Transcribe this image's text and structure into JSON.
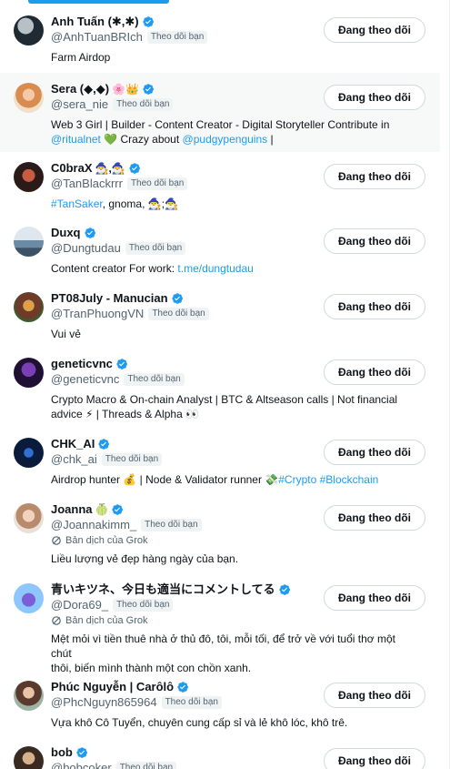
{
  "follow_label": "Đang theo dõi",
  "follows_you_label": "Theo dõi bạn",
  "grok_label": "Bản dịch của Grok",
  "colors": {
    "accent": "#1d9bf0",
    "verified": "#1d9bf0",
    "text": "#0f1419",
    "muted": "#536471",
    "border": "#cfd9de",
    "highlight_row": "#f7f9f9"
  },
  "users": [
    {
      "name": "Anh Tuấn (✱,✱)",
      "handle": "@AnhTuanBRIch",
      "bio": [
        "Farm Airdop"
      ]
    },
    {
      "name": "Sera (◆,◆)",
      "name_emoji": "🌸👑",
      "handle": "@sera_nie",
      "bio_prefix": "Web 3 Girl | Builder - Content Creator - Digital Storyteller Contribute in",
      "bio_link1": "@ritualnet",
      "bio_mid": "💚 Crazy about",
      "bio_link2": "@pudgypenguins",
      "bio_suffix": "|"
    },
    {
      "name": "C0braX",
      "name_emoji": "🧙‍♂️,🧙‍♂️",
      "handle": "@TanBlackrrr",
      "bio_link1": "#TanSaker",
      "bio_suffix": ", gnoma, 🧙‍♂️;🧙‍♂️"
    },
    {
      "name": "Duxq",
      "handle": "@Dungtudau",
      "bio_prefix": "Content creator For work:",
      "bio_link1": "t.me/dungtudau"
    },
    {
      "name": "PT08July - Manucian",
      "handle": "@TranPhuongVN",
      "bio": [
        "Vui vẻ"
      ]
    },
    {
      "name": "geneticvnc",
      "handle": "@geneticvnc",
      "bio": [
        "Crypto Macro & On-chain Analyst | BTC & Altseason calls | Not financial",
        "advice ⚡ | Threads & Alpha 👀"
      ]
    },
    {
      "name": "CHK_AI",
      "handle": "@chk_ai",
      "bio_prefix": "Airdrop hunter 💰 | Node & Validator runner 💸",
      "bio_link1": "#Crypto",
      "bio_link2": "#Blockchain"
    },
    {
      "name": "Joanna",
      "name_emoji": "🍈",
      "handle": "@Joannakimm_",
      "grok": true,
      "bio": [
        "Liều lượng vẻ đẹp hàng ngày của bạn."
      ]
    },
    {
      "name": "青いキツネ、今日も適当にコメントしてる",
      "handle": "@Dora69_",
      "grok": true,
      "bio": [
        "Mệt mỏi vì tiền thuê nhà ở thủ đô, tôi, mỗi tối, để trở về với tuổi thơ một chút",
        "thôi, biến mình thành một con chồn xanh."
      ]
    },
    {
      "name": "Phúc Nguyễn | Carôlô",
      "handle": "@PhcNguyn865964",
      "bio": [
        "Vựa khô Cô Tuyển, chuyên cung cấp sỉ và lẻ khô lóc, khô trê."
      ]
    },
    {
      "name": "bob",
      "handle": "@bobcoker"
    }
  ]
}
